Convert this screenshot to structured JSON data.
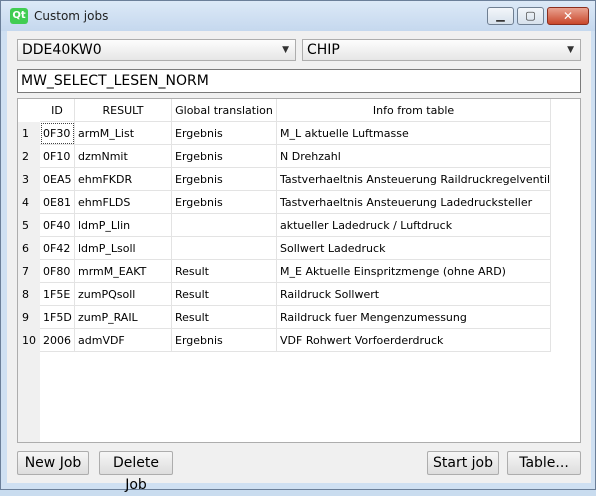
{
  "window": {
    "title": "Custom jobs",
    "logo_text": "Qt"
  },
  "controls": {
    "ecu_combo": "DDE40KW0",
    "job_combo": "CHIP",
    "job_name": "MW_SELECT_LESEN_NORM"
  },
  "table": {
    "columns": [
      "ID",
      "RESULT",
      "Global translation",
      "Info from table"
    ],
    "rows": [
      {
        "num": "1",
        "id": "0F30",
        "result": "armM_List",
        "translation": "Ergebnis",
        "info": "M_L aktuelle Luftmasse"
      },
      {
        "num": "2",
        "id": "0F10",
        "result": "dzmNmit",
        "translation": "Ergebnis",
        "info": "N Drehzahl"
      },
      {
        "num": "3",
        "id": "0EA5",
        "result": "ehmFKDR",
        "translation": "Ergebnis",
        "info": "Tastverhaeltnis Ansteuerung Raildruckregelventil"
      },
      {
        "num": "4",
        "id": "0E81",
        "result": "ehmFLDS",
        "translation": "Ergebnis",
        "info": "Tastverhaeltnis Ansteuerung Ladedrucksteller"
      },
      {
        "num": "5",
        "id": "0F40",
        "result": "ldmP_Llin",
        "translation": "",
        "info": "aktueller Ladedruck  / Luftdruck"
      },
      {
        "num": "6",
        "id": "0F42",
        "result": "ldmP_Lsoll",
        "translation": "",
        "info": "Sollwert Ladedruck"
      },
      {
        "num": "7",
        "id": "0F80",
        "result": "mrmM_EAKT",
        "translation": "Result",
        "info": "M_E Aktuelle Einspritzmenge (ohne ARD)"
      },
      {
        "num": "8",
        "id": "1F5E",
        "result": "zumPQsoll",
        "translation": "Result",
        "info": "Raildruck Sollwert"
      },
      {
        "num": "9",
        "id": "1F5D",
        "result": "zumP_RAIL",
        "translation": "Result",
        "info": "Raildruck fuer Mengenzumessung"
      },
      {
        "num": "10",
        "id": "2006",
        "result": "admVDF",
        "translation": "Ergebnis",
        "info": "VDF Rohwert Vorfoerderdruck"
      }
    ]
  },
  "buttons": {
    "new_job": "New Job",
    "delete_job": "Delete Job",
    "start_job": "Start job",
    "table": "Table..."
  },
  "icons": {
    "minimize": "minimize-icon",
    "maximize": "maximize-icon",
    "close": "close-icon",
    "dropdown": "chevron-down-icon"
  }
}
